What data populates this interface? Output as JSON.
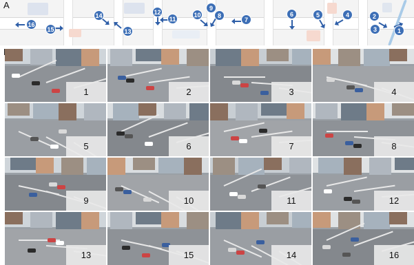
{
  "panel_a": {
    "letter": "A",
    "colors": {
      "camera_marker": "#3d6fb6",
      "arrow": "#2f5fa8"
    },
    "cameras": [
      "16",
      "15",
      "14",
      "13",
      "12",
      "11",
      "10",
      "9",
      "8",
      "7",
      "6",
      "5",
      "4",
      "2",
      "3",
      "1"
    ]
  },
  "panel_b": {
    "letter": "B",
    "tiles": [
      {
        "label": "1"
      },
      {
        "label": "2"
      },
      {
        "label": "3"
      },
      {
        "label": "4"
      },
      {
        "label": "5"
      },
      {
        "label": "6"
      },
      {
        "label": "7"
      },
      {
        "label": "8"
      },
      {
        "label": "9"
      },
      {
        "label": "10"
      },
      {
        "label": "11"
      },
      {
        "label": "12"
      },
      {
        "label": "13"
      },
      {
        "label": "15"
      },
      {
        "label": "14"
      },
      {
        "label": "16"
      }
    ]
  }
}
